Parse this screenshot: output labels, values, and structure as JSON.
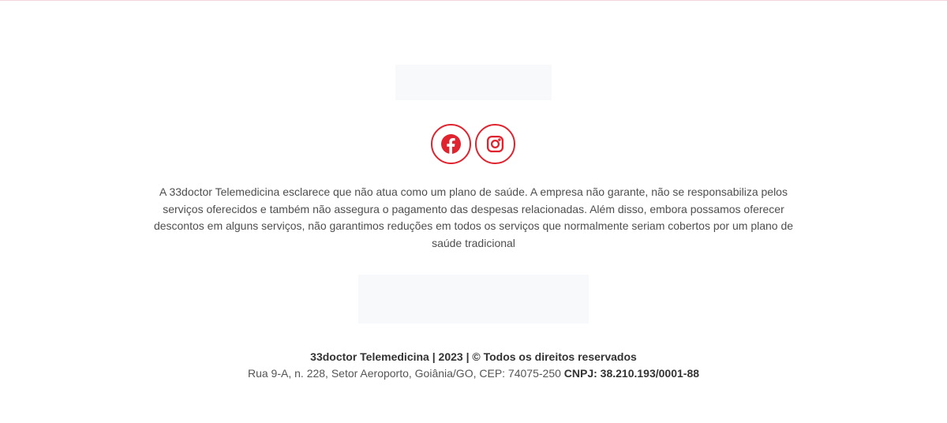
{
  "colors": {
    "accent": "#e0242f",
    "text": "#4e4e4e",
    "placeholder_bg": "#f8f9fb"
  },
  "socials": [
    {
      "name": "Facebook",
      "icon": "facebook-icon"
    },
    {
      "name": "Instagram",
      "icon": "instagram-icon"
    }
  ],
  "disclaimer": "A 33doctor Telemedicina esclarece que não atua como um plano de saúde. A empresa não garante, não se responsabiliza pelos serviços oferecidos e também não assegura o pagamento das despesas relacionadas. Além disso, embora possamos oferecer descontos em alguns serviços, não garantimos reduções em todos os serviços que normalmente seriam cobertos por um plano de saúde tradicional",
  "footer": {
    "copyright": "33doctor Telemedicina | 2023 | © Todos os direitos reservados",
    "address": "Rua 9-A, n. 228, Setor Aeroporto, Goiânia/GO, CEP: 74075-250",
    "cnpj": "CNPJ: 38.210.193/0001-88"
  }
}
